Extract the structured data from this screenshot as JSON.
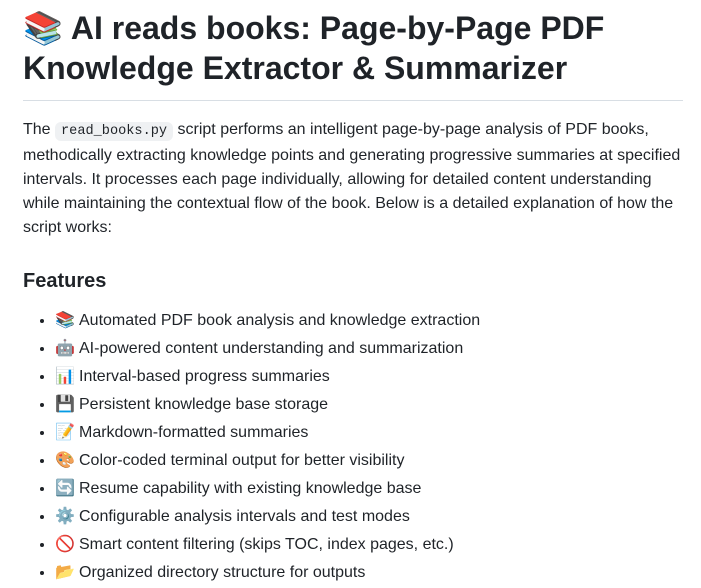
{
  "title": {
    "icon": "books-icon",
    "emoji": "📚",
    "text": "AI reads books: Page-by-Page PDF Knowledge Extractor & Summarizer"
  },
  "intro": {
    "before": "The ",
    "code": "read_books.py",
    "after": " script performs an intelligent page-by-page analysis of PDF books, methodically extracting knowledge points and generating progressive summaries at specified intervals. It processes each page individually, allowing for detailed content understanding while maintaining the contextual flow of the book. Below is a detailed explanation of how the script works:"
  },
  "features": {
    "heading": "Features",
    "items": [
      {
        "icon": "books-icon",
        "emoji": "📚",
        "text": "Automated PDF book analysis and knowledge extraction"
      },
      {
        "icon": "robot-icon",
        "emoji": "🤖",
        "text": "AI-powered content understanding and summarization"
      },
      {
        "icon": "bar-chart-icon",
        "emoji": "📊",
        "text": "Interval-based progress summaries"
      },
      {
        "icon": "floppy-disk-icon",
        "emoji": "💾",
        "text": "Persistent knowledge base storage"
      },
      {
        "icon": "memo-icon",
        "emoji": "📝",
        "text": "Markdown-formatted summaries"
      },
      {
        "icon": "palette-icon",
        "emoji": "🎨",
        "text": "Color-coded terminal output for better visibility"
      },
      {
        "icon": "refresh-icon",
        "emoji": "🔄",
        "text": "Resume capability with existing knowledge base"
      },
      {
        "icon": "gear-icon",
        "emoji": "⚙️",
        "text": "Configurable analysis intervals and test modes"
      },
      {
        "icon": "prohibited-icon",
        "emoji": "🚫",
        "text": "Smart content filtering (skips TOC, index pages, etc.)"
      },
      {
        "icon": "open-folder-icon",
        "emoji": "📂",
        "text": "Organized directory structure for outputs"
      }
    ]
  }
}
